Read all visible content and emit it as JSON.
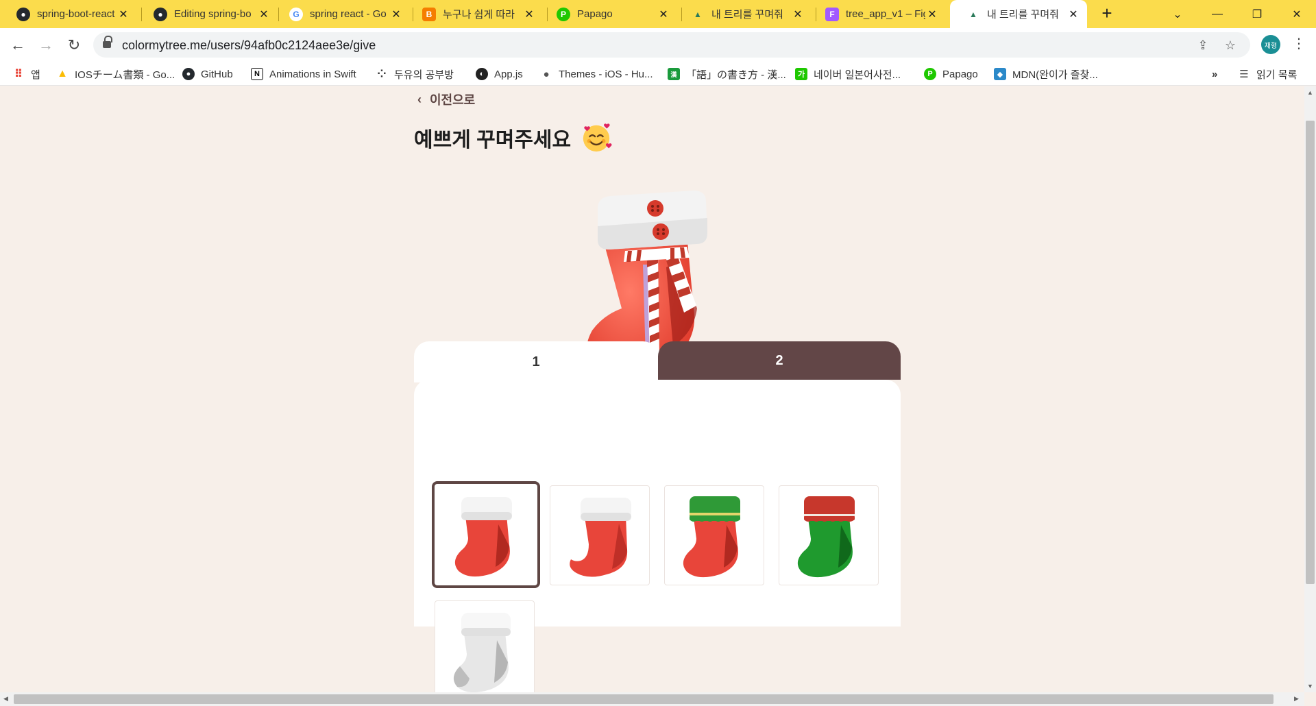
{
  "browser": {
    "tabs": [
      {
        "title": "spring-boot-react",
        "icon": "github-icon",
        "fav": "●",
        "fav_bg": "#24292e"
      },
      {
        "title": "Editing spring-bo",
        "icon": "github-icon",
        "fav": "●",
        "fav_bg": "#24292e"
      },
      {
        "title": "spring react - Go",
        "icon": "google-icon",
        "fav": "G",
        "fav_bg": "#ffffff"
      },
      {
        "title": "누구나 쉽게 따라",
        "icon": "blogger-icon",
        "fav": "B",
        "fav_bg": "#f57d00"
      },
      {
        "title": "Papago",
        "icon": "papago-icon",
        "fav": "P",
        "fav_bg": "#1ec800"
      },
      {
        "title": "내 트리를 꾸며줘",
        "icon": "tree-icon",
        "fav": "▲",
        "fav_bg": "#2a7a5a"
      },
      {
        "title": "tree_app_v1 – Fig",
        "icon": "figma-icon",
        "fav": "F",
        "fav_bg": "#a259ff"
      },
      {
        "title": "내 트리를 꾸며줘",
        "icon": "tree-icon",
        "fav": "▲",
        "fav_bg": "#2a7a5a"
      }
    ],
    "url": "colormytree.me/users/94afb0c2124aee3e/give",
    "profile_initials": "재형"
  },
  "bookmarks": [
    {
      "label": "앱",
      "icon": "apps-grid-icon"
    },
    {
      "label": "IOSチーム書類 - Go...",
      "icon": "google-drive-icon"
    },
    {
      "label": "GitHub",
      "icon": "github-icon"
    },
    {
      "label": "Animations in Swift",
      "icon": "notion-icon"
    },
    {
      "label": "두유의 공부방",
      "icon": "dots-icon"
    },
    {
      "label": "App.js",
      "icon": "globe-icon"
    },
    {
      "label": "Themes - iOS - Hu...",
      "icon": "apple-icon"
    },
    {
      "label": "「語」の書き方 - 漢...",
      "icon": "kanji-icon"
    },
    {
      "label": "네이버 일본어사전...",
      "icon": "naver-dict-icon"
    },
    {
      "label": "Papago",
      "icon": "papago-icon"
    },
    {
      "label": "MDN(완이가 즐찾...",
      "icon": "mdn-icon"
    }
  ],
  "bookmarks_more": "»",
  "reading_list": "읽기 목록",
  "page": {
    "back_label": "이전으로",
    "title": "예쁘게 꾸며주세요",
    "title_emoji": "smiling-face-with-hearts",
    "tabs": [
      {
        "label": "1",
        "active": true
      },
      {
        "label": "2",
        "active": false
      }
    ],
    "stockings": [
      {
        "name": "red-white-cuff",
        "selected": true
      },
      {
        "name": "red-curled-toe",
        "selected": false
      },
      {
        "name": "red-green-cuff",
        "selected": false
      },
      {
        "name": "green-red-cuff",
        "selected": false
      },
      {
        "name": "white-grey",
        "selected": false
      }
    ]
  }
}
